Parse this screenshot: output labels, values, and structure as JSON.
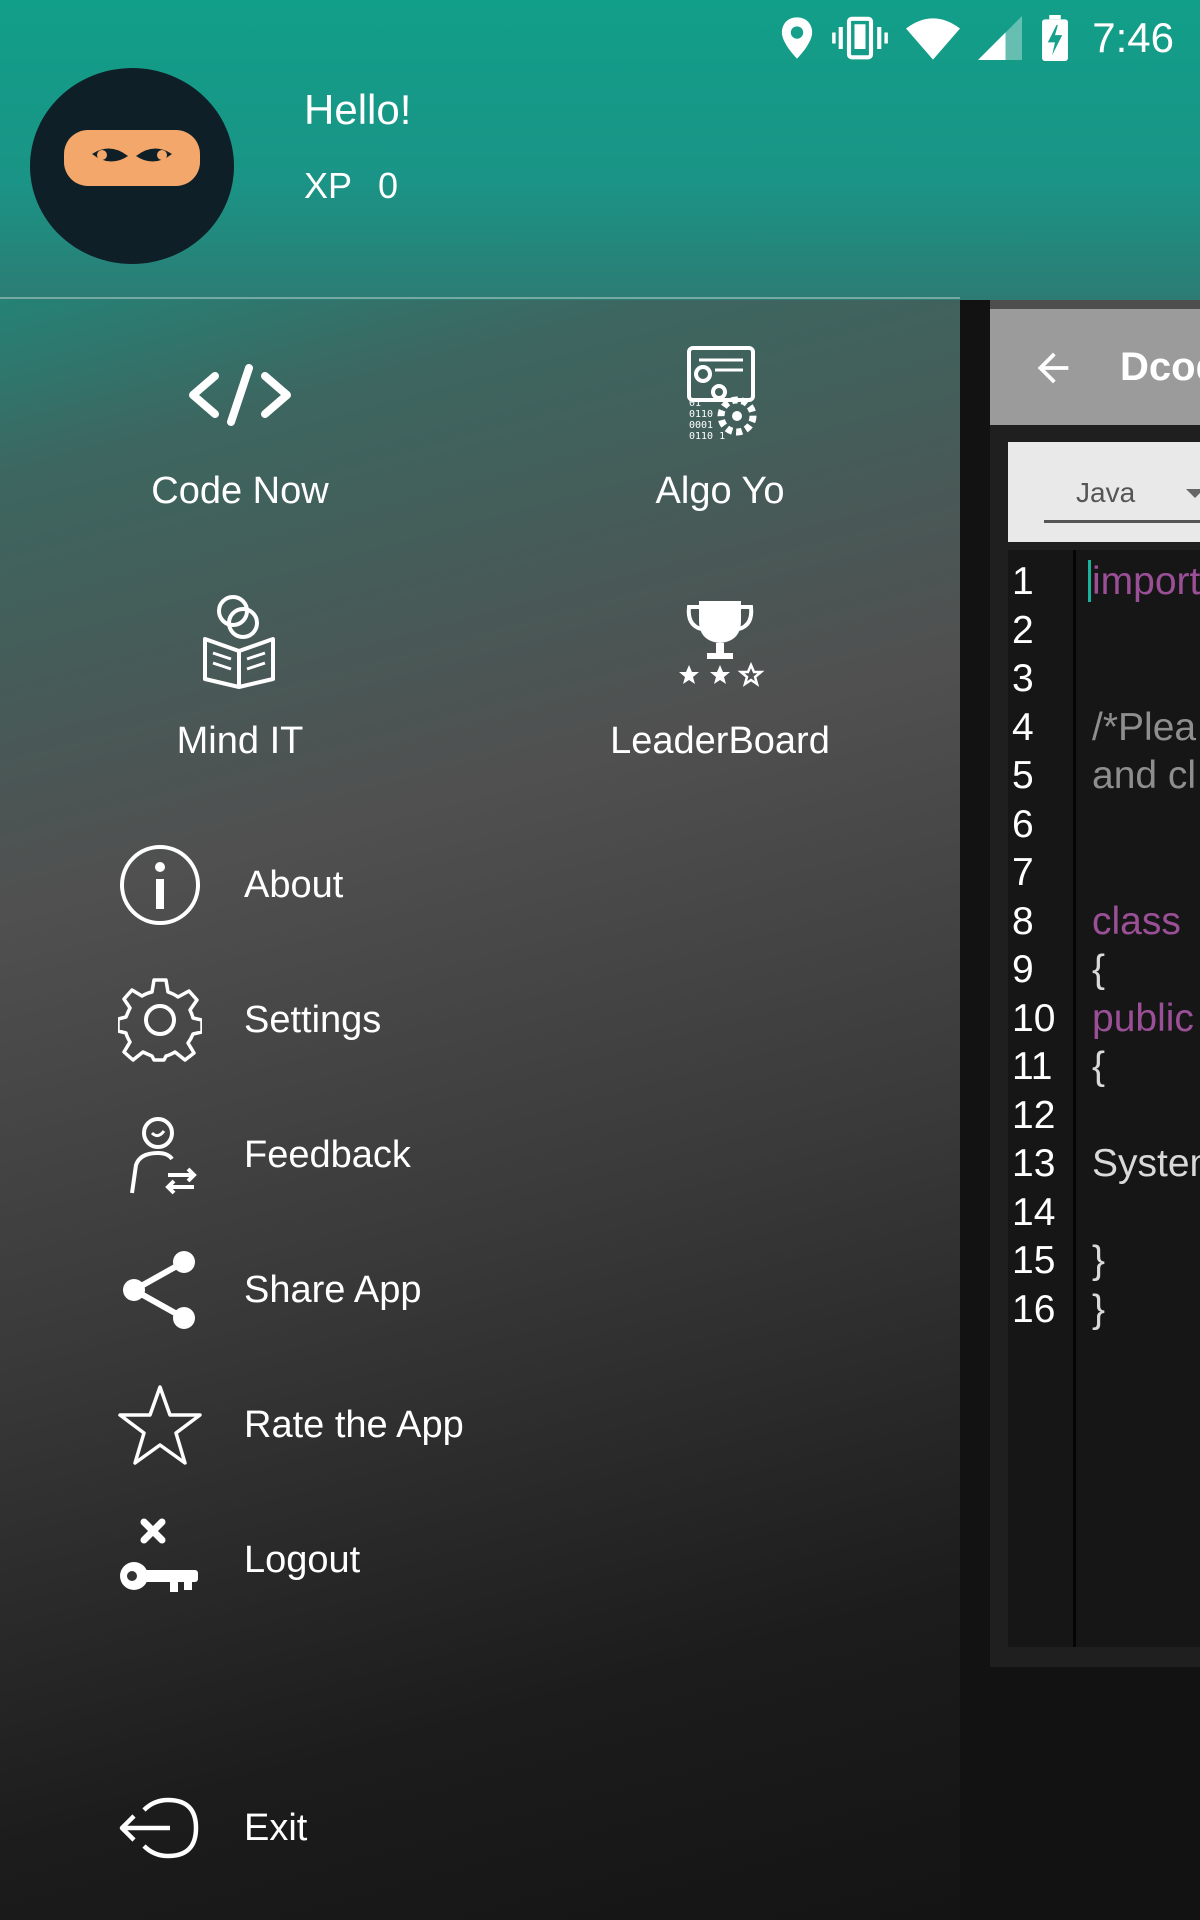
{
  "status_bar": {
    "time": "7:46",
    "icons": [
      "location-icon",
      "vibrate-icon",
      "wifi-icon",
      "signal-icon",
      "battery-charging-icon"
    ]
  },
  "drawer": {
    "greeting": "Hello!",
    "xp_label": "XP",
    "xp_value": "0",
    "tiles": [
      {
        "label": "Code Now",
        "icon": "code-icon"
      },
      {
        "label": "Algo Yo",
        "icon": "algorithm-icon"
      },
      {
        "label": "Mind IT",
        "icon": "reader-icon"
      },
      {
        "label": "LeaderBoard",
        "icon": "trophy-icon"
      }
    ],
    "menu": [
      {
        "label": "About",
        "icon": "info-icon"
      },
      {
        "label": "Settings",
        "icon": "gear-icon"
      },
      {
        "label": "Feedback",
        "icon": "feedback-icon"
      },
      {
        "label": "Share App",
        "icon": "share-icon"
      },
      {
        "label": "Rate the App",
        "icon": "star-icon"
      },
      {
        "label": "Logout",
        "icon": "logout-key-icon"
      }
    ],
    "exit_label": "Exit"
  },
  "background_app": {
    "title": "Dcod",
    "language": "Java",
    "line_numbers": [
      "1",
      "2",
      "3",
      "4",
      "5",
      "6",
      "7",
      "8",
      "9",
      "10",
      "11",
      "12",
      "13",
      "14",
      "15",
      "16"
    ],
    "code_lines": [
      {
        "line": 1,
        "text": "import",
        "kind": "keyword"
      },
      {
        "line": 4,
        "text": "/*Plea",
        "kind": "comment"
      },
      {
        "line": 5,
        "text": "and cl",
        "kind": "comment"
      },
      {
        "line": 8,
        "text": "class",
        "kind": "keyword"
      },
      {
        "line": 9,
        "text": "{",
        "kind": "plain"
      },
      {
        "line": 10,
        "text": "public",
        "kind": "keyword"
      },
      {
        "line": 11,
        "text": "{",
        "kind": "plain"
      },
      {
        "line": 13,
        "text": "System",
        "kind": "plain"
      },
      {
        "line": 15,
        "text": "}",
        "kind": "plain"
      },
      {
        "line": 16,
        "text": "}",
        "kind": "plain"
      }
    ]
  },
  "colors": {
    "accent": "#129f8a",
    "keyword": "#9a4f96",
    "comment": "#8e8e8e",
    "avatar_mask": "#f4a76a"
  }
}
